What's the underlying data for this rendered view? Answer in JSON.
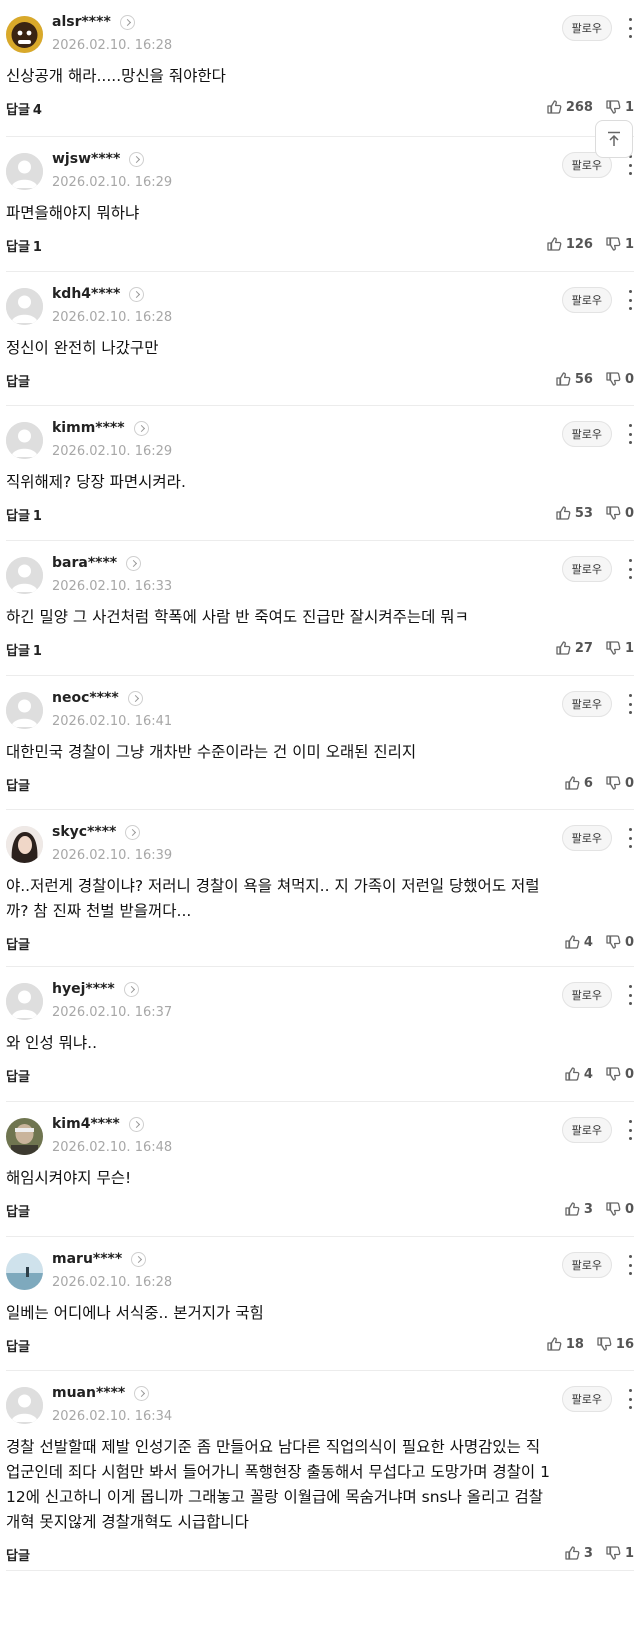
{
  "follow_label": "팔로우",
  "reply_label": "답글",
  "comments": [
    {
      "user": "alsr****",
      "time": "2026.02.10. 16:28",
      "text": [
        "신상공개 해라.....망신을 줘야한다"
      ],
      "replies": "4",
      "likes": "268",
      "dislikes": "1",
      "avatar": "photo"
    },
    {
      "user": "wjsw****",
      "time": "2026.02.10. 16:29",
      "text": [
        "파면을해야지 뭐하냐"
      ],
      "replies": "1",
      "likes": "126",
      "dislikes": "1",
      "avatar": "default"
    },
    {
      "user": "kdh4****",
      "time": "2026.02.10. 16:28",
      "text": [
        "정신이 완전히 나갔구만"
      ],
      "replies": "",
      "likes": "56",
      "dislikes": "0",
      "avatar": "default"
    },
    {
      "user": "kimm****",
      "time": "2026.02.10. 16:29",
      "text": [
        "직위해제? 당장 파면시켜라."
      ],
      "replies": "1",
      "likes": "53",
      "dislikes": "0",
      "avatar": "default"
    },
    {
      "user": "bara****",
      "time": "2026.02.10. 16:33",
      "text": [
        "하긴 밀양 그 사건처럼 학폭에 사람 반 죽여도 진급만 잘시켜주는데 뭐ㅋ"
      ],
      "replies": "1",
      "likes": "27",
      "dislikes": "1",
      "avatar": "default"
    },
    {
      "user": "neoc****",
      "time": "2026.02.10. 16:41",
      "text": [
        "대한민국 경찰이 그냥 개차반 수준이라는 건 이미 오래된 진리지"
      ],
      "replies": "",
      "likes": "6",
      "dislikes": "0",
      "avatar": "default"
    },
    {
      "user": "skyc****",
      "time": "2026.02.10. 16:39",
      "text": [
        "야..저런게 경찰이냐? 저러니 경찰이 욕을 쳐먹지.. 지 가족이 저런일 당했어도 저럴",
        "까? 참 진짜 천벌 받을꺼다..."
      ],
      "replies": "",
      "likes": "4",
      "dislikes": "0",
      "avatar": "photo"
    },
    {
      "user": "hyej****",
      "time": "2026.02.10. 16:37",
      "text": [
        "와 인성 뭐냐.."
      ],
      "replies": "",
      "likes": "4",
      "dislikes": "0",
      "avatar": "default"
    },
    {
      "user": "kim4****",
      "time": "2026.02.10. 16:48",
      "text": [
        "해임시켜야지 무슨!"
      ],
      "replies": "",
      "likes": "3",
      "dislikes": "0",
      "avatar": "photo"
    },
    {
      "user": "maru****",
      "time": "2026.02.10. 16:28",
      "text": [
        "일베는 어디에나 서식중.. 본거지가 국힘"
      ],
      "replies": "",
      "likes": "18",
      "dislikes": "16",
      "avatar": "photo"
    },
    {
      "user": "muan****",
      "time": "2026.02.10. 16:34",
      "text": [
        "경찰 선발할때 제발 인성기준 좀 만들어요 남다른 직업의식이 필요한 사명감있는 직",
        "업군인데 죄다 시험만 봐서 들어가니 폭행현장 출동해서 무섭다고 도망가며 경찰이 1",
        "12에 신고하니 이게 몹니까 그래놓고 꼴랑 이월급에 목숨거냐며 sns나 올리고 검찰",
        "개혁 못지않게 경찰개혁도 시급합니다"
      ],
      "replies": "",
      "likes": "3",
      "dislikes": "1",
      "avatar": "default"
    }
  ],
  "colors": {
    "accent_follow_bg": "#f6f6f6",
    "timestamp": "#a7a7a7",
    "divider": "#ececec"
  },
  "icons": {
    "like": "thumbs-up-icon",
    "dislike": "thumbs-down-icon",
    "more": "kebab-menu-icon",
    "scroll_top": "scroll-to-top-icon"
  }
}
